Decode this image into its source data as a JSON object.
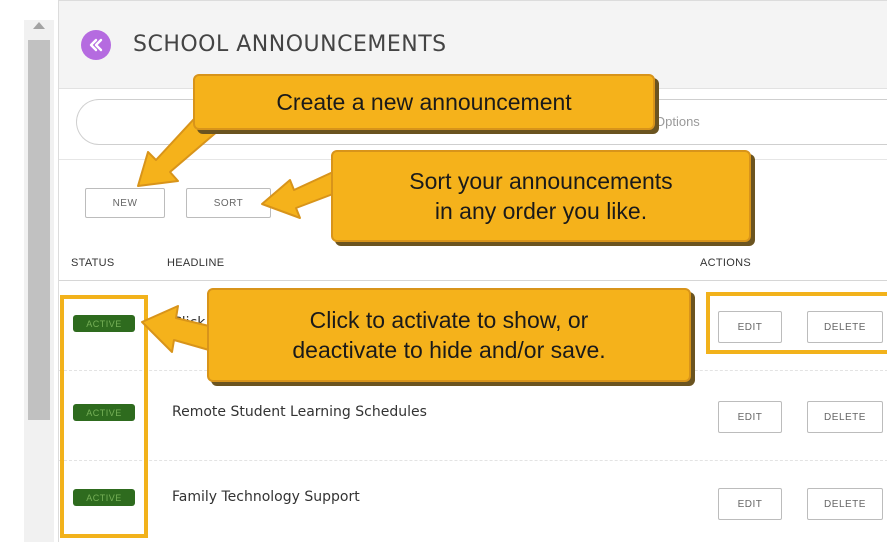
{
  "panel": {
    "title": "SCHOOL ANNOUNCEMENTS",
    "options_label": "Options"
  },
  "toolbar": {
    "new_label": "NEW",
    "sort_label": "SORT"
  },
  "table": {
    "columns": [
      "STATUS",
      "HEADLINE",
      "ACTIONS"
    ],
    "rows": [
      {
        "status": "ACTIVE",
        "headline": "Click",
        "edit": "EDIT",
        "delete": "DELETE"
      },
      {
        "status": "ACTIVE",
        "headline": "Remote Student Learning Schedules",
        "edit": "EDIT",
        "delete": "DELETE"
      },
      {
        "status": "ACTIVE",
        "headline": "Family Technology Support",
        "edit": "EDIT",
        "delete": "DELETE"
      }
    ]
  },
  "callouts": {
    "create": "Create a new announcement",
    "sort_line1": "Sort your announcements",
    "sort_line2": "in any order you like.",
    "activate_line1": "Click to activate to show, or",
    "activate_line2": "deactivate to hide and/or save."
  },
  "colors": {
    "accent": "#b56be0",
    "callout": "#f5b21b",
    "active_badge": "#2e6b1e"
  },
  "icons": {
    "back": "chevron-double-left-icon"
  }
}
